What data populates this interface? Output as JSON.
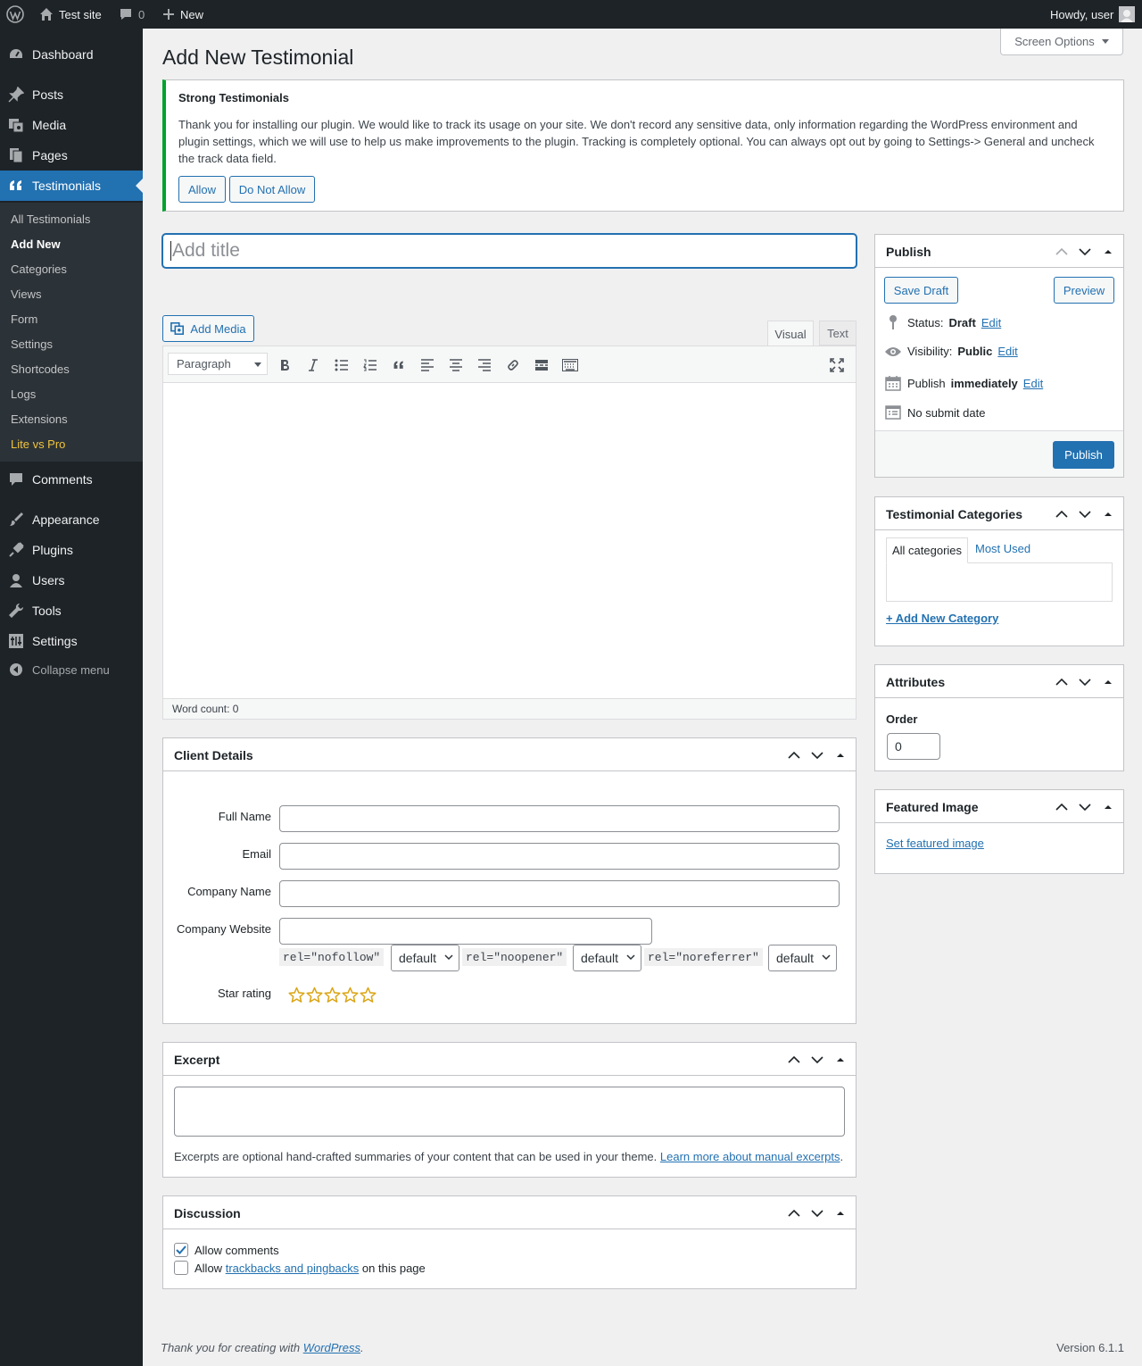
{
  "adminbar": {
    "site_name": "Test site",
    "comments_count": "0",
    "new_label": "New",
    "howdy": "Howdy, user"
  },
  "sidebar": {
    "items": [
      {
        "label": "Dashboard",
        "icon": "dashboard-icon"
      },
      {
        "label": "Posts",
        "icon": "pin-icon"
      },
      {
        "label": "Media",
        "icon": "media-icon"
      },
      {
        "label": "Pages",
        "icon": "pages-icon"
      },
      {
        "label": "Testimonials",
        "icon": "quote-icon"
      },
      {
        "label": "Comments",
        "icon": "comment-icon"
      },
      {
        "label": "Appearance",
        "icon": "brush-icon"
      },
      {
        "label": "Plugins",
        "icon": "plug-icon"
      },
      {
        "label": "Users",
        "icon": "user-icon"
      },
      {
        "label": "Tools",
        "icon": "wrench-icon"
      },
      {
        "label": "Settings",
        "icon": "settings-icon"
      },
      {
        "label": "Collapse menu",
        "icon": "collapse-icon"
      }
    ],
    "submenu": [
      "All Testimonials",
      "Add New",
      "Categories",
      "Views",
      "Form",
      "Settings",
      "Shortcodes",
      "Logs",
      "Extensions",
      "Lite vs Pro"
    ]
  },
  "page": {
    "title": "Add New Testimonial",
    "screen_options": "Screen Options"
  },
  "notice": {
    "heading": "Strong Testimonials",
    "text": "Thank you for installing our plugin. We would like to track its usage on your site. We don't record any sensitive data, only information regarding the WordPress environment and plugin settings, which we will use to help us make improvements to the plugin. Tracking is completely optional. You can always opt out by going to Settings-> General and uncheck the track data field.",
    "allow": "Allow",
    "deny": "Do Not Allow"
  },
  "editor": {
    "title_placeholder": "Add title",
    "add_media": "Add Media",
    "tab_visual": "Visual",
    "tab_text": "Text",
    "format": "Paragraph",
    "word_count": "Word count: 0"
  },
  "client_details": {
    "heading": "Client Details",
    "full_name": "Full Name",
    "email": "Email",
    "company_name": "Company Name",
    "company_website": "Company Website",
    "rel_nofollow": "rel=\"nofollow\"",
    "rel_noopener": "rel=\"noopener\"",
    "rel_noreferrer": "rel=\"noreferrer\"",
    "default": "default",
    "star_rating": "Star rating",
    "stars": 0
  },
  "excerpt": {
    "heading": "Excerpt",
    "help": "Excerpts are optional hand-crafted summaries of your content that can be used in your theme.",
    "link": "Learn more about manual excerpts",
    "period": "."
  },
  "discussion": {
    "heading": "Discussion",
    "allow_comments": "Allow comments",
    "allow_prefix": "Allow",
    "trackbacks_link": "trackbacks and pingbacks",
    "allow_suffix": "on this page"
  },
  "publish": {
    "heading": "Publish",
    "save_draft": "Save Draft",
    "preview": "Preview",
    "status_label": "Status:",
    "status_value": "Draft",
    "visibility_label": "Visibility:",
    "visibility_value": "Public",
    "publish_label": "Publish",
    "publish_value": "immediately",
    "edit": "Edit",
    "no_submit": "No submit date",
    "publish_button": "Publish"
  },
  "categories": {
    "heading": "Testimonial Categories",
    "tab_all": "All categories",
    "tab_most_used": "Most Used",
    "add_new": "+ Add New Category"
  },
  "attributes": {
    "heading": "Attributes",
    "order_label": "Order",
    "order_value": "0"
  },
  "featured": {
    "heading": "Featured Image",
    "link": "Set featured image"
  },
  "footer": {
    "thanks": "Thank you for creating with",
    "wordpress": "WordPress",
    "period": ".",
    "version": "Version 6.1.1"
  },
  "colors": {
    "accent": "#2271b1",
    "adminbar": "#1d2327",
    "notice_border": "#00a32a",
    "star": "#dba617"
  }
}
